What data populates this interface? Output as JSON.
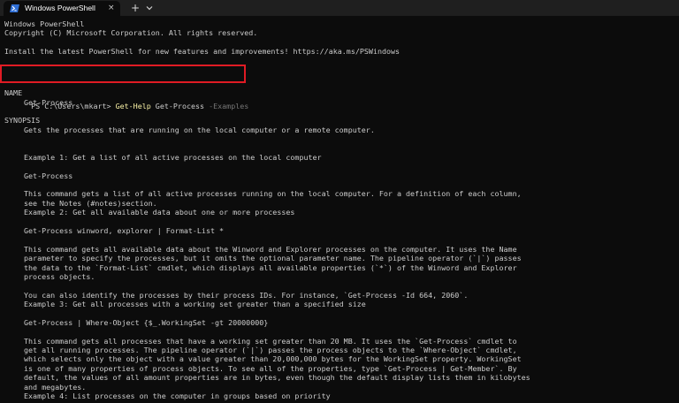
{
  "window": {
    "tab_title": "Windows PowerShell",
    "tab_icon": "powershell-icon",
    "close_glyph": "×",
    "new_tab_glyph": "+",
    "dropdown_icon": "chevron-down-icon"
  },
  "colors": {
    "background": "#0c0c0c",
    "text": "#cccccc",
    "command": "#f9f1a5",
    "parameter": "#767676",
    "highlight_box": "#e01b24"
  },
  "terminal": {
    "banner": [
      "Windows PowerShell",
      "Copyright (C) Microsoft Corporation. All rights reserved.",
      "Install the latest PowerShell for new features and improvements! https://aka.ms/PSWindows"
    ],
    "prompt": {
      "path": "PS C:\\Users\\mkart> ",
      "command": "Get-Help",
      "argument": " Get-Process ",
      "parameter": "-Examples"
    },
    "name_header": "NAME",
    "name_value": "Get-Process",
    "synopsis_header": "SYNOPSIS",
    "synopsis_value": "Gets the processes that are running on the local computer or a remote computer.",
    "ex1_title": "Example 1: Get a list of all active processes on the local computer",
    "ex1_code": "Get-Process",
    "ex1_desc": [
      "This command gets a list of all active processes running on the local computer. For a definition of each column,",
      "see the Notes (#notes)section."
    ],
    "ex2_title": "Example 2: Get all available data about one or more processes",
    "ex2_code": "Get-Process winword, explorer | Format-List *",
    "ex2_desc": [
      "This command gets all available data about the Winword and Explorer processes on the computer. It uses the Name",
      "parameter to specify the processes, but it omits the optional parameter name. The pipeline operator (`|`) passes",
      "the data to the `Format-List` cmdlet, which displays all available properties (`*`) of the Winword and Explorer",
      "process objects."
    ],
    "ex2_note": "You can also identify the processes by their process IDs. For instance, `Get-Process -Id 664, 2060`.",
    "ex3_title": "Example 3: Get all processes with a working set greater than a specified size",
    "ex3_code": "Get-Process | Where-Object {$_.WorkingSet -gt 20000000}",
    "ex3_desc": [
      "This command gets all processes that have a working set greater than 20 MB. It uses the `Get-Process` cmdlet to",
      "get all running processes. The pipeline operator (`|`) passes the process objects to the `Where-Object` cmdlet,",
      "which selects only the object with a value greater than 20,000,000 bytes for the WorkingSet property. WorkingSet",
      "is one of many properties of process objects. To see all of the properties, type `Get-Process | Get-Member`. By",
      "default, the values of all amount properties are in bytes, even though the default display lists them in kilobytes",
      "and megabytes."
    ],
    "ex4_title": "Example 4: List processes on the computer in groups based on priority"
  }
}
